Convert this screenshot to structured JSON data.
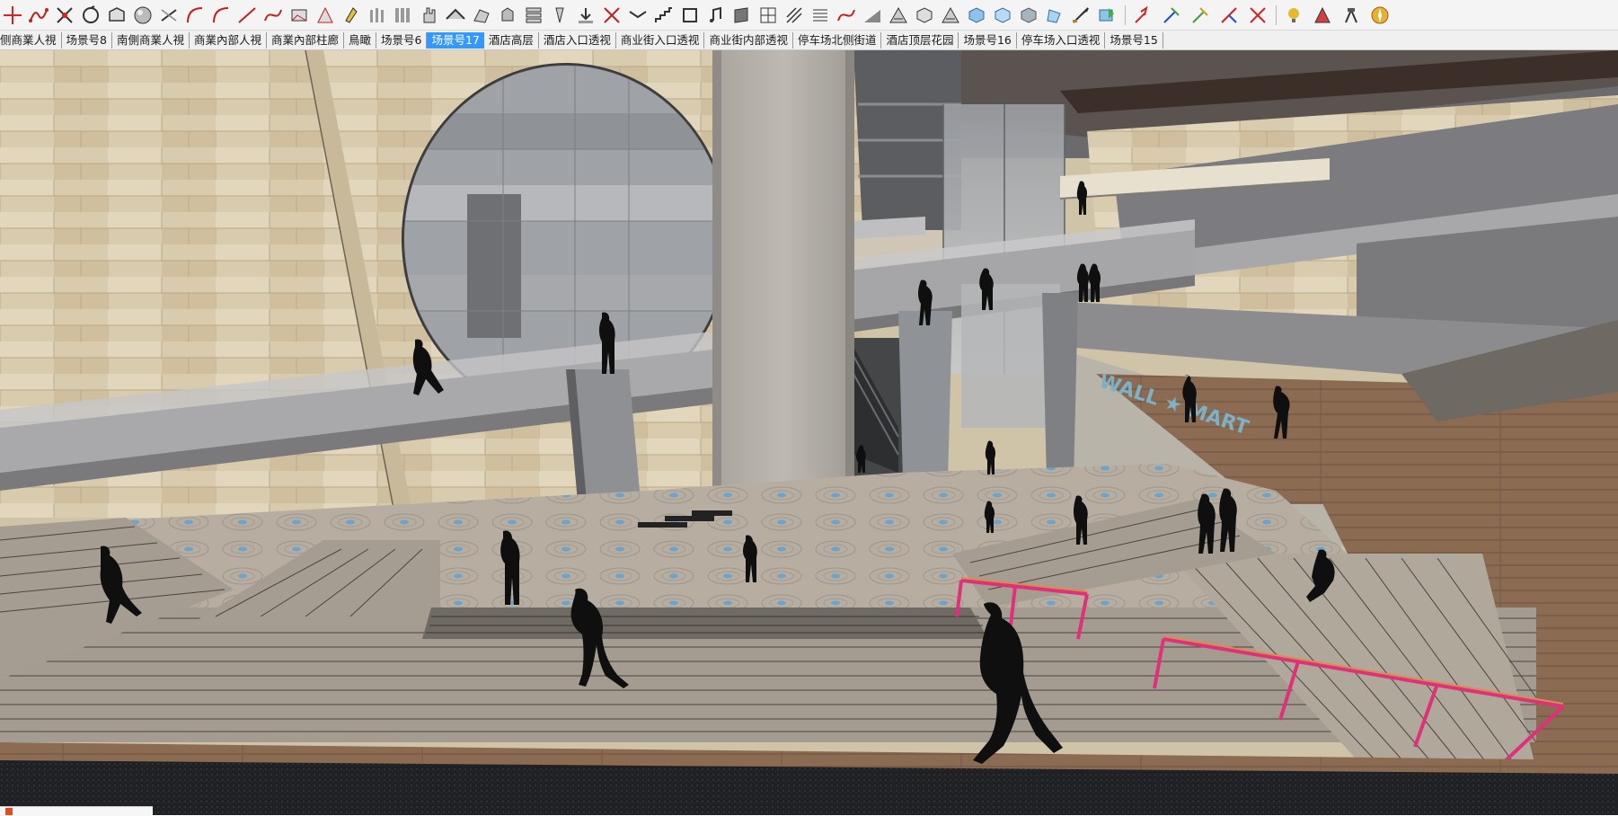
{
  "toolbar": {
    "tools": [
      {
        "name": "move-icon"
      },
      {
        "name": "freehand-curve-icon"
      },
      {
        "name": "erase-icon"
      },
      {
        "name": "rotate-icon"
      },
      {
        "name": "offset-icon"
      },
      {
        "name": "sphere-icon"
      },
      {
        "name": "follow-me-icon"
      },
      {
        "name": "arc-icon"
      },
      {
        "name": "arc-icon"
      },
      {
        "name": "line-icon"
      },
      {
        "name": "curve-icon"
      },
      {
        "name": "profile-icon"
      },
      {
        "name": "section-icon"
      },
      {
        "name": "paint-icon"
      },
      {
        "name": "columns-icon"
      },
      {
        "name": "array-icon"
      },
      {
        "name": "hand-icon"
      },
      {
        "name": "roof-icon"
      },
      {
        "name": "surface-icon"
      },
      {
        "name": "extrude-icon"
      },
      {
        "name": "stack-icon"
      },
      {
        "name": "pin-icon"
      },
      {
        "name": "push-icon"
      },
      {
        "name": "cross-icon"
      },
      {
        "name": "fold-icon"
      },
      {
        "name": "stair-icon"
      },
      {
        "name": "frame-icon"
      },
      {
        "name": "music-icon"
      },
      {
        "name": "wall-icon"
      },
      {
        "name": "grid-icon"
      },
      {
        "name": "pattern-icon"
      },
      {
        "name": "lines-icon"
      },
      {
        "name": "curve-icon"
      },
      {
        "name": "slope-icon"
      },
      {
        "name": "hatch-icon"
      },
      {
        "name": "box-icon"
      },
      {
        "name": "hatch-icon"
      },
      {
        "name": "cube-front-icon"
      },
      {
        "name": "cube-back-icon"
      },
      {
        "name": "cube-solid-icon"
      },
      {
        "name": "shape-icon"
      },
      {
        "name": "sword-icon"
      },
      {
        "name": "export-icon"
      },
      {
        "name": "arrow-red-icon"
      },
      {
        "name": "arrow-blue-icon"
      },
      {
        "name": "arrow-green-icon"
      },
      {
        "name": "axis-red-icon"
      },
      {
        "name": "axis-multi-icon"
      },
      {
        "name": "tool-bulb-icon"
      },
      {
        "name": "paint-tool-icon"
      },
      {
        "name": "brush-icon"
      },
      {
        "name": "compass-icon"
      }
    ]
  },
  "scene_tabs": [
    {
      "label": "侧商業人視",
      "active": false
    },
    {
      "label": "场景号8",
      "active": false
    },
    {
      "label": "南側商業人視",
      "active": false
    },
    {
      "label": "商業內部人視",
      "active": false
    },
    {
      "label": "商業內部柱廊",
      "active": false
    },
    {
      "label": "鳥瞰",
      "active": false
    },
    {
      "label": "场景号6",
      "active": false
    },
    {
      "label": "场景号17",
      "active": true
    },
    {
      "label": "酒店高层",
      "active": false
    },
    {
      "label": "酒店入口透视",
      "active": false
    },
    {
      "label": "商业街入口透视",
      "active": false
    },
    {
      "label": "商业街内部透视",
      "active": false
    },
    {
      "label": "停车场北侧街道",
      "active": false
    },
    {
      "label": "酒店顶层花园",
      "active": false
    },
    {
      "label": "场景号16",
      "active": false
    },
    {
      "label": "停车场入口透视",
      "active": false
    },
    {
      "label": "场景号15",
      "active": false
    }
  ],
  "viewport": {
    "store_sign": "WALL ★ MART"
  },
  "colors": {
    "active_tab": "#3399ff",
    "wall_stone": "#d8c9ab",
    "floor_mosaic": "#b5aca0",
    "rail_pink": "#e0307a",
    "wood_floor": "#8a6a52"
  }
}
